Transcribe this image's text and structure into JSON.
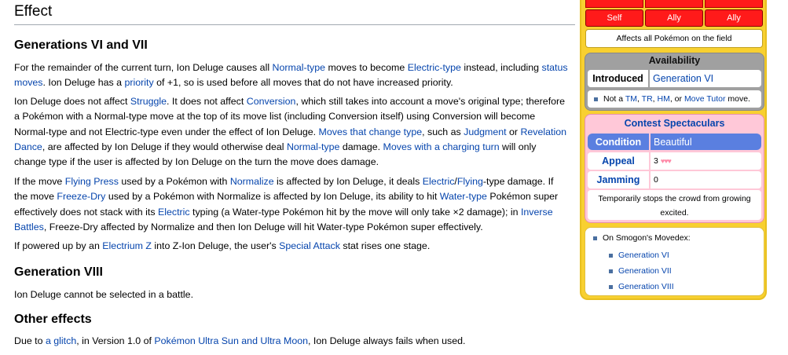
{
  "article": {
    "heading": "Effect",
    "sections": [
      {
        "title": "Generations VI and VII",
        "paragraphs": [
          [
            {
              "t": "For the remainder of the current turn, Ion Deluge causes all "
            },
            {
              "t": "Normal-type",
              "link": true
            },
            {
              "t": " moves to become "
            },
            {
              "t": "Electric-type",
              "link": true
            },
            {
              "t": " instead, including "
            },
            {
              "t": "status moves",
              "link": true
            },
            {
              "t": ". Ion Deluge has a "
            },
            {
              "t": "priority",
              "link": true
            },
            {
              "t": " of +1, so is used before all moves that do not have increased priority."
            }
          ],
          [
            {
              "t": "Ion Deluge does not affect "
            },
            {
              "t": "Struggle",
              "link": true
            },
            {
              "t": ". It does not affect "
            },
            {
              "t": "Conversion",
              "link": true
            },
            {
              "t": ", which still takes into account a move's original type; therefore a Pokémon with a Normal-type move at the top of its move list (including Conversion itself) using Conversion will become Normal-type and not Electric-type even under the effect of Ion Deluge. "
            },
            {
              "t": "Moves that change type",
              "link": true
            },
            {
              "t": ", such as "
            },
            {
              "t": "Judgment",
              "link": true
            },
            {
              "t": " or "
            },
            {
              "t": "Revelation Dance",
              "link": true
            },
            {
              "t": ", are affected by Ion Deluge if they would otherwise deal "
            },
            {
              "t": "Normal-type",
              "link": true
            },
            {
              "t": " damage. "
            },
            {
              "t": "Moves with a charging turn",
              "link": true
            },
            {
              "t": " will only change type if the user is affected by Ion Deluge on the turn the move does damage."
            }
          ],
          [
            {
              "t": "If the move "
            },
            {
              "t": "Flying Press",
              "link": true
            },
            {
              "t": " used by a Pokémon with "
            },
            {
              "t": "Normalize",
              "link": true
            },
            {
              "t": " is affected by Ion Deluge, it deals "
            },
            {
              "t": "Electric",
              "link": true
            },
            {
              "t": "/"
            },
            {
              "t": "Flying",
              "link": true
            },
            {
              "t": "-type damage. If the move "
            },
            {
              "t": "Freeze-Dry",
              "link": true
            },
            {
              "t": " used by a Pokémon with Normalize is affected by Ion Deluge, its ability to hit "
            },
            {
              "t": "Water-type",
              "link": true
            },
            {
              "t": " Pokémon super effectively does not stack with its "
            },
            {
              "t": "Electric",
              "link": true
            },
            {
              "t": " typing (a Water-type Pokémon hit by the move will only take ×2 damage); in "
            },
            {
              "t": "Inverse Battles",
              "link": true
            },
            {
              "t": ", Freeze-Dry affected by Normalize and then Ion Deluge will hit Water-type Pokémon super effectively."
            }
          ],
          [
            {
              "t": "If powered up by an "
            },
            {
              "t": "Electrium Z",
              "link": true
            },
            {
              "t": " into Z-Ion Deluge, the user's "
            },
            {
              "t": "Special Attack",
              "link": true
            },
            {
              "t": " stat rises one stage."
            }
          ]
        ]
      },
      {
        "title": "Generation VIII",
        "paragraphs": [
          [
            {
              "t": "Ion Deluge cannot be selected in a battle."
            }
          ]
        ]
      },
      {
        "title": "Other effects",
        "paragraphs": [
          [
            {
              "t": "Due to "
            },
            {
              "t": "a glitch",
              "link": true
            },
            {
              "t": ", in Version 1.0 of "
            },
            {
              "t": "Pokémon Ultra Sun and Ultra Moon",
              "link": true
            },
            {
              "t": ", Ion Deluge always fails when used."
            }
          ]
        ]
      }
    ]
  },
  "sidebar": {
    "targets": [
      "Self",
      "Ally",
      "Ally"
    ],
    "target_description": "Affects all Pokémon on the field",
    "availability": {
      "title": "Availability",
      "introduced_label": "Introduced",
      "introduced_value": "Generation VI",
      "note_parts": [
        {
          "t": "Not a "
        },
        {
          "t": "TM",
          "link": true
        },
        {
          "t": ", "
        },
        {
          "t": "TR",
          "link": true
        },
        {
          "t": ", "
        },
        {
          "t": "HM",
          "link": true
        },
        {
          "t": ", or "
        },
        {
          "t": "Move Tutor",
          "link": true
        },
        {
          "t": " move."
        }
      ]
    },
    "contest": {
      "title": "Contest Spectaculars",
      "condition_label": "Condition",
      "condition_value": "Beautiful",
      "appeal_label": "Appeal",
      "appeal_value": "3",
      "appeal_hearts": "♥♥♥",
      "jamming_label": "Jamming",
      "jamming_value": "0",
      "description": "Temporarily stops the crowd from growing excited."
    },
    "smogon": {
      "heading": "On Smogon's Movedex:",
      "links": [
        "Generation VI",
        "Generation VII",
        "Generation VIII"
      ]
    }
  },
  "colors": {
    "link": "#0645ad",
    "sidebar_bg": "#f8d030",
    "target_red": "#ff1a1a",
    "condition_blue": "#5a7fe0",
    "contest_pink": "#ffc8d8",
    "availability_gray": "#a0a0a0"
  }
}
